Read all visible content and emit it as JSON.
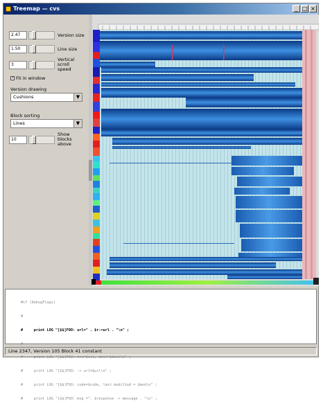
{
  "window": {
    "title": "Treemap — cvs"
  },
  "controls": {
    "version_size": {
      "value": "2.47",
      "label": "Version size"
    },
    "line_size": {
      "value": "1.50",
      "label": "Line size"
    },
    "vertical_scroll": {
      "value": "3",
      "label": "Vertical scroll speed"
    },
    "fit_window": {
      "label": "Fit in window",
      "checked": true
    },
    "version_drawing": {
      "label": "Version drawing",
      "selected": "Cushions"
    },
    "block_sorting": {
      "label": "Block sorting",
      "selected": "Lines"
    },
    "show_blocks": {
      "value": "10",
      "label": "Show blocks above"
    }
  },
  "code_lines": [
    "#if (DebugFlags)",
    "#",
    "#     print LOG \"[$$]FOO: url=\" . $r->url . \"\\n\" ;",
    "#",
    "#     print LOG \"[$$]FOO: src=$src, dest=$dest\\n\" ;",
    "#     print LOG \"[$$]FOO: -> url=$url\\n\" ;",
    "#     print LOG \"[$$]FOO: code=$code, last modified = $mod\\n\" ;",
    "#     print LOG \"[$$]FOO: msg =\". $response -> message . \"\\n\" ;"
  ],
  "status": {
    "text": "Line 2347, Version 105 Block 41 constant"
  },
  "colors": {
    "titlebar": "#0a246a",
    "cushion": "#1e63b8",
    "pale": "#bfe3e8",
    "pink": "#e8b4b8"
  }
}
